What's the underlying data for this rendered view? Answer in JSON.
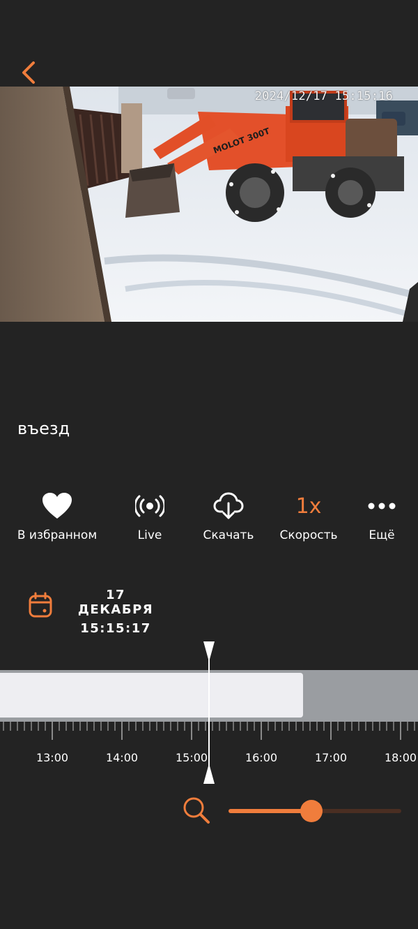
{
  "colors": {
    "background": "#232323",
    "accent": "#f07d3c",
    "timeline_recorded": "#eeeef2",
    "timeline_empty": "#9a9da1"
  },
  "video": {
    "timestamp": "2024/12/17  15:15:16"
  },
  "camera": {
    "name": "въезд"
  },
  "actions": [
    {
      "icon": "heart-icon",
      "label": "В избранном"
    },
    {
      "icon": "live-broadcast-icon",
      "label": "Live"
    },
    {
      "icon": "cloud-download-icon",
      "label": "Скачать"
    },
    {
      "icon": "speed",
      "label": "Скорость",
      "value": "1x"
    },
    {
      "icon": "more-dots-icon",
      "label": "Ещё"
    }
  ],
  "date": {
    "day": "17 ДЕКАБРЯ",
    "time": "15:15:17"
  },
  "timeline": {
    "labels": [
      "13:00",
      "14:00",
      "15:00",
      "16:00",
      "17:00",
      "18:00"
    ]
  },
  "zoom": {
    "level": 0.48
  }
}
